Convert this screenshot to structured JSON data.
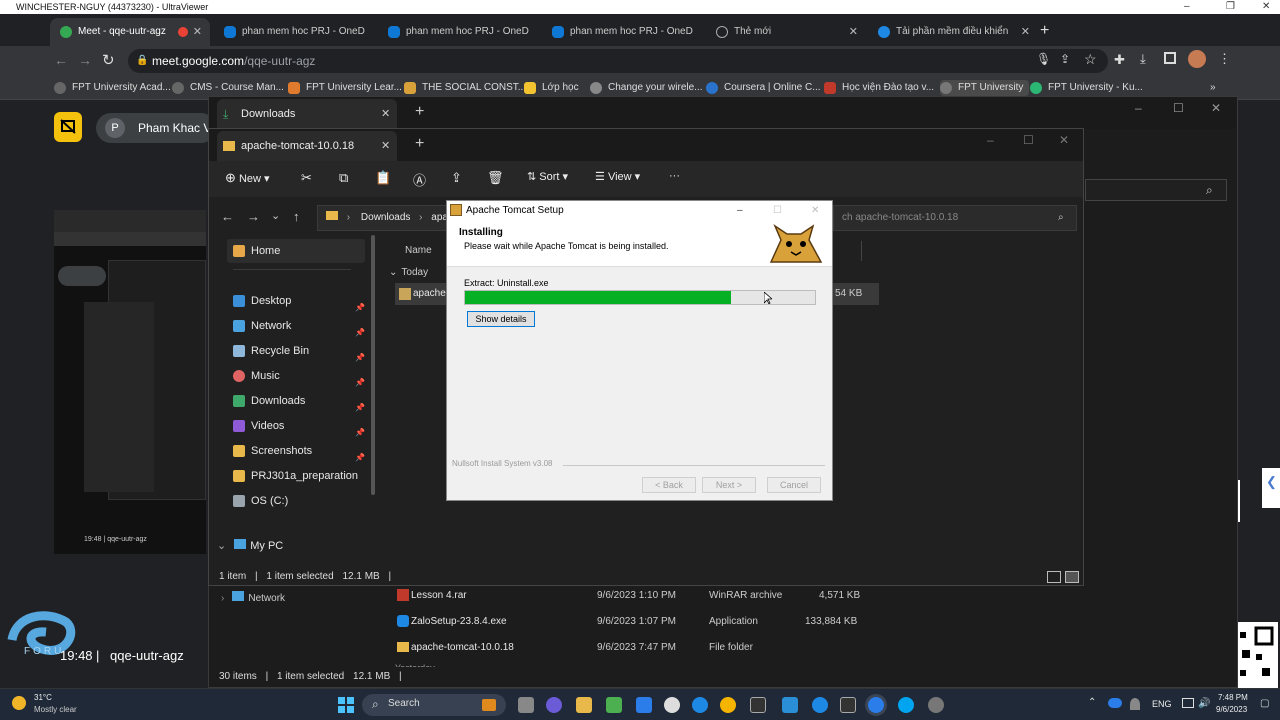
{
  "uv_title": "WINCHESTER-NGUY (44373230) - UltraViewer",
  "chrome": {
    "tabs": [
      {
        "label": "Meet - qqe-uutr-agz",
        "active": true
      },
      {
        "label": "phan mem hoc PRJ - OneD"
      },
      {
        "label": "phan mem hoc PRJ - OneD"
      },
      {
        "label": "phan mem hoc PRJ - OneD"
      },
      {
        "label": "Thẻ mới"
      },
      {
        "label": "Tải phần mềm điều khiển"
      }
    ],
    "url_host": "meet.google.com",
    "url_path": "/qqe-uutr-agz",
    "bookmarks": [
      "FPT University Acad...",
      "CMS - Course Man...",
      "FPT University Lear...",
      "THE SOCIAL CONST...",
      "Lớp học",
      "Change your wirele...",
      "Coursera | Online C...",
      "Học viện Đào tạo v...",
      "FPT University",
      "FPT University - Ku..."
    ],
    "more": "»"
  },
  "meet": {
    "participant_initial": "P",
    "participant_name": "Pham Khac V",
    "clock": "19:48",
    "meeting_code": "qqe-uutr-agz",
    "logo_text": "FORU"
  },
  "explorer_back": {
    "tab": "Downloads",
    "files": [
      {
        "name": "Lesson 4.rar",
        "date": "9/6/2023 1:10 PM",
        "type": "WinRAR archive",
        "size": "4,571 KB"
      },
      {
        "name": "ZaloSetup-23.8.4.exe",
        "date": "9/6/2023 1:07 PM",
        "type": "Application",
        "size": "133,884 KB"
      },
      {
        "name": "apache-tomcat-10.0.18",
        "date": "9/6/2023 7:47 PM",
        "type": "File folder",
        "size": ""
      }
    ],
    "network_label": "Network",
    "yesterday": "Yesterday",
    "status_items": "30 items",
    "status_selected": "1 item selected",
    "status_size": "12.1 MB"
  },
  "explorer_front": {
    "tab": "apache-tomcat-10.0.18",
    "toolbar": {
      "new": "New",
      "sort": "Sort",
      "view": "View",
      "more": "···"
    },
    "breadcrumb": [
      "Downloads",
      "apache-"
    ],
    "search_placeholder": "ch apache-tomcat-10.0.18",
    "nav": [
      {
        "label": "Home",
        "icon": "home-icon",
        "color": "#e8a84a"
      },
      {
        "label": "Desktop",
        "icon": "desktop-icon",
        "color": "#3b8fd9",
        "pin": true
      },
      {
        "label": "Network",
        "icon": "network-icon",
        "color": "#4aa3df",
        "pin": true
      },
      {
        "label": "Recycle Bin",
        "icon": "recycle-bin-icon",
        "color": "#8fb7d9",
        "pin": true
      },
      {
        "label": "Music",
        "icon": "music-icon",
        "color": "#e06464",
        "pin": true
      },
      {
        "label": "Downloads",
        "icon": "downloads-icon",
        "color": "#3fa86b",
        "pin": true
      },
      {
        "label": "Videos",
        "icon": "videos-icon",
        "color": "#8e5ad6",
        "pin": true
      },
      {
        "label": "Screenshots",
        "icon": "folder-icon",
        "color": "#e8b84a",
        "pin": true
      },
      {
        "label": "PRJ301a_preparation",
        "icon": "folder-icon",
        "color": "#e8b84a"
      },
      {
        "label": "OS (C:)",
        "icon": "drive-icon",
        "color": "#9aa4ad"
      }
    ],
    "my_pc": "My PC",
    "col_name": "Name",
    "group_today": "Today",
    "file_name": "apache-",
    "file_size": "54 KB",
    "status_items": "1 item",
    "status_selected": "1 item selected",
    "status_size": "12.1 MB"
  },
  "installer": {
    "title": "Apache Tomcat Setup",
    "heading": "Installing",
    "subheading": "Please wait while Apache Tomcat is being installed.",
    "status": "Extract: Uninstall.exe",
    "progress": 0.76,
    "show_details": "Show details",
    "brand": "Nullsoft Install System v3.08",
    "back": "< Back",
    "next": "Next >",
    "cancel": "Cancel"
  },
  "taskbar": {
    "temp": "31°C",
    "weather": "Mostly clear",
    "search": "Search",
    "lang": "ENG",
    "time": "7:48 PM",
    "date": "9/6/2023"
  }
}
